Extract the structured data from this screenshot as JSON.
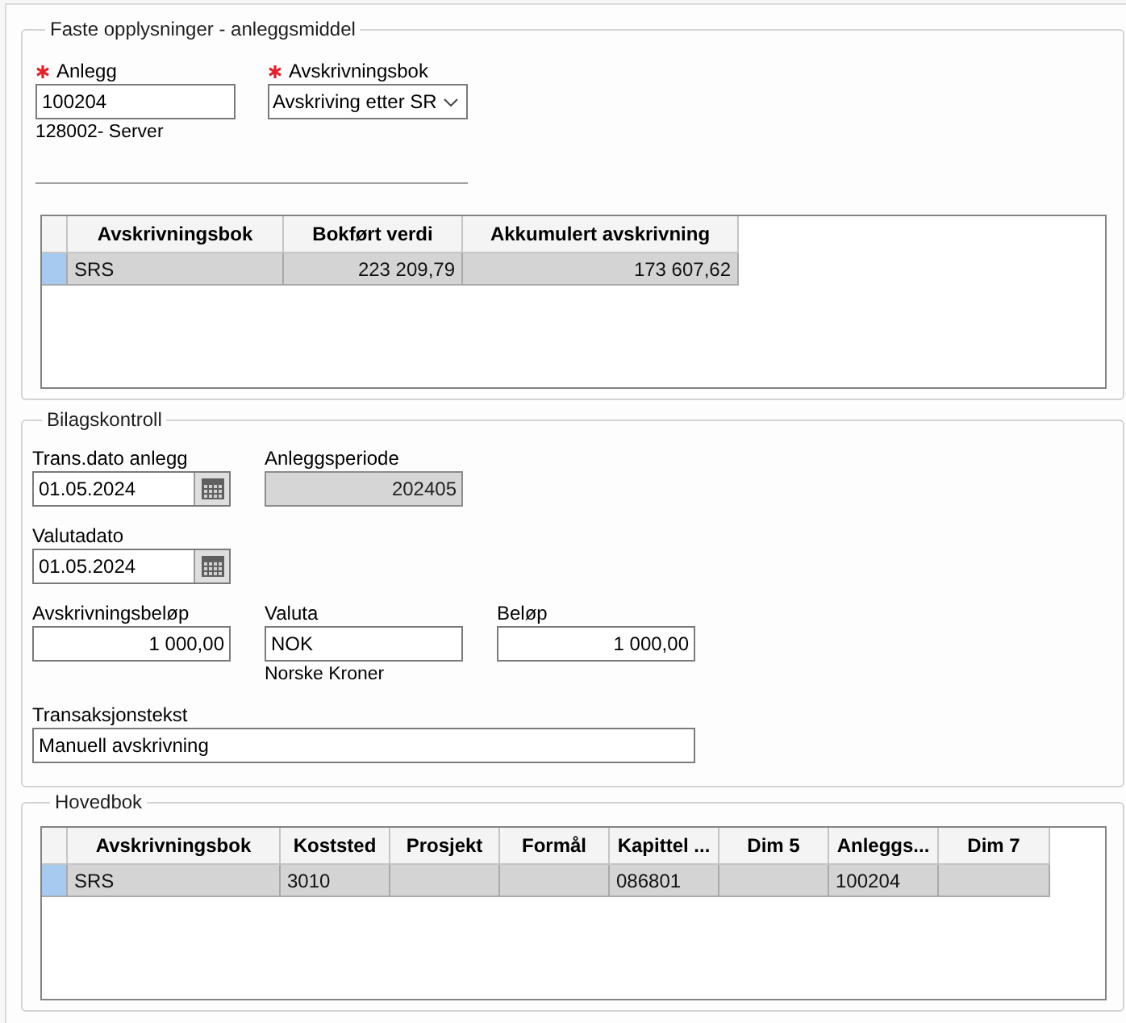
{
  "asset_group": {
    "title": "Faste opplysninger - anleggsmiddel",
    "fields": [
      {
        "kind": "text",
        "label": "Anlegg",
        "required": true,
        "value": "100204",
        "description": "128002- Server"
      },
      {
        "kind": "dropdown",
        "label": "Avskrivningsbok",
        "required": true,
        "value": "Avskriving etter SR"
      }
    ],
    "table": {
      "columns": [
        {
          "label": "Avskrivningsbok",
          "right_aligned": false
        },
        {
          "label": "Bokført verdi",
          "right_aligned": true
        },
        {
          "label": "Akkumulert avskrivning",
          "right_aligned": true
        }
      ],
      "rows": [
        {
          "selected": true,
          "cells": [
            "SRS",
            "223 209,79",
            "173 607,62"
          ]
        }
      ]
    }
  },
  "voucher_group": {
    "title": "Bilagskontroll",
    "rows": [
      {
        "fields": [
          {
            "kind": "date",
            "label": "Trans.dato anlegg",
            "value": "01.05.2024",
            "disabled": false,
            "right_aligned": false
          },
          {
            "kind": "text",
            "label": "Anleggsperiode",
            "value": "202405",
            "disabled": true,
            "right_aligned": true
          }
        ]
      },
      {
        "fields": [
          {
            "kind": "date",
            "label": "Valutadato",
            "value": "01.05.2024",
            "disabled": false,
            "right_aligned": false
          }
        ]
      },
      {
        "fields": [
          {
            "kind": "text",
            "label": "Avskrivningsbeløp",
            "value": "1 000,00",
            "disabled": false,
            "right_aligned": true
          },
          {
            "kind": "text",
            "label": "Valuta",
            "value": "NOK",
            "disabled": false,
            "right_aligned": false,
            "description": "Norske Kroner"
          },
          {
            "kind": "text",
            "label": "Beløp",
            "value": "1 000,00",
            "disabled": false,
            "right_aligned": true
          }
        ]
      },
      {
        "fields": [
          {
            "kind": "long_text",
            "label": "Transaksjonstekst",
            "value": "Manuell avskrivning",
            "disabled": false,
            "right_aligned": false
          }
        ]
      }
    ]
  },
  "ledger_group": {
    "title": "Hovedbok",
    "table": {
      "columns": [
        {
          "label": "Avskrivningsbok"
        },
        {
          "label": "Koststed"
        },
        {
          "label": "Prosjekt"
        },
        {
          "label": "Formål"
        },
        {
          "label": "Kapittel ..."
        },
        {
          "label": "Dim 5"
        },
        {
          "label": "Anleggs..."
        },
        {
          "label": "Dim 7"
        }
      ],
      "rows": [
        {
          "selected": true,
          "cells": [
            "SRS",
            "3010",
            null,
            null,
            "086801",
            null,
            "100204",
            null
          ]
        }
      ]
    }
  }
}
